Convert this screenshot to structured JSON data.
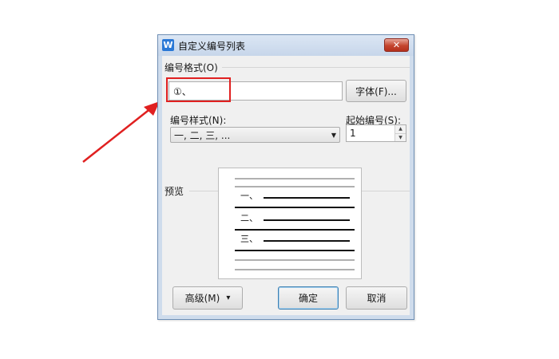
{
  "dialog": {
    "title": "自定义编号列表",
    "app_icon_glyph": "W",
    "close_glyph": "✕"
  },
  "format_group": {
    "label": "编号格式(O)",
    "format_value": "①、",
    "font_button": "字体(F)..."
  },
  "style": {
    "label": "编号样式(N):",
    "selected": "一, 二, 三, ..."
  },
  "start": {
    "label": "起始编号(S):",
    "value": "1"
  },
  "preview": {
    "label": "预览",
    "items": [
      "一、",
      "二、",
      "三、"
    ]
  },
  "buttons": {
    "advanced": "高级(M)",
    "advanced_glyph": "▾",
    "ok": "确定",
    "cancel": "取消"
  },
  "colors": {
    "highlight": "#e02020",
    "title_bar": "#cfdcec",
    "close_button": "#c4452f"
  }
}
